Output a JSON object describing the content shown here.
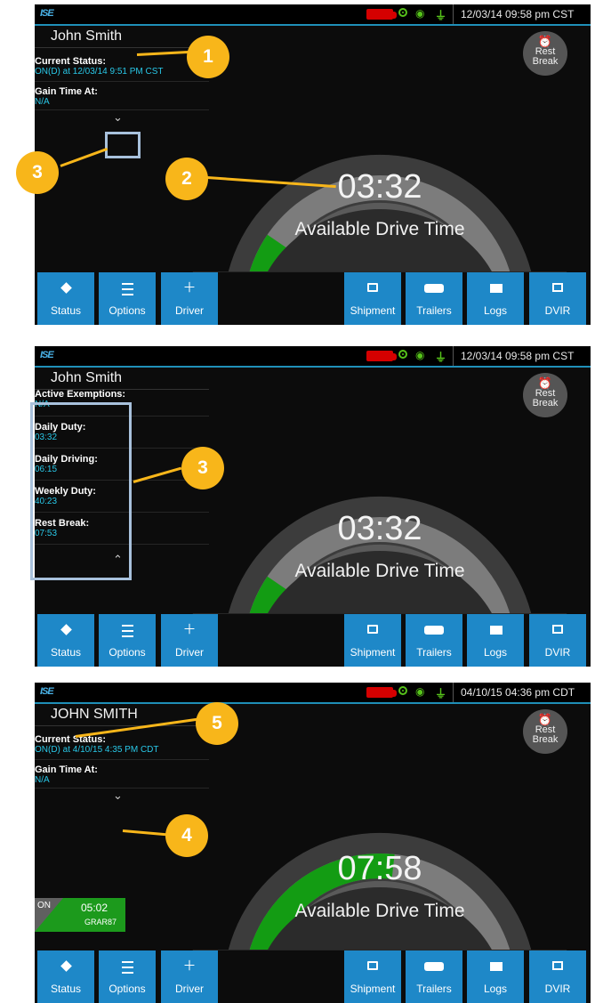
{
  "panels": [
    {
      "clock": "12/03/14 09:58 pm CST",
      "driver": "John Smith",
      "fields": [
        {
          "label": "Current Status:",
          "value": "ON(D) at 12/03/14 9:51 PM CST"
        },
        {
          "label": "Gain Time At:",
          "value": "N/A"
        }
      ],
      "toggle_icon": "chevron-down-icon",
      "time": "03:32",
      "caption": "Available Drive Time",
      "gauge_fraction": 0.23
    },
    {
      "clock": "12/03/14 09:58 pm CST",
      "driver": "John Smith",
      "fields": [
        {
          "label": "Active Exemptions:",
          "value": "N/A"
        },
        {
          "label": "Daily Duty:",
          "value": "03:32"
        },
        {
          "label": "Daily Driving:",
          "value": "06:15"
        },
        {
          "label": "Weekly Duty:",
          "value": "40:23"
        },
        {
          "label": "Rest Break:",
          "value": "07:53"
        }
      ],
      "toggle_icon": "chevron-up-icon",
      "time": "03:32",
      "caption": "Available Drive Time",
      "gauge_fraction": 0.23
    },
    {
      "clock": "04/10/15 04:36 pm CDT",
      "driver": "JOHN SMITH",
      "fields": [
        {
          "label": "Current Status:",
          "value": "ON(D) at 4/10/15 4:35 PM CDT"
        },
        {
          "label": "Gain Time At:",
          "value": "N/A"
        }
      ],
      "toggle_icon": "chevron-down-icon",
      "time": "07:58",
      "caption": "Available Drive Time",
      "gauge_fraction": 0.53,
      "tile": {
        "status": "ON",
        "time": "05:02",
        "code": "GRAR87"
      }
    }
  ],
  "rest_break": {
    "line1": "Rest",
    "line2": "Break",
    "icon": "alarm-clock-icon"
  },
  "buttons_left": [
    {
      "label": "Status",
      "icon": "status-diamond-icon"
    },
    {
      "label": "Options",
      "icon": "options-list-icon"
    },
    {
      "label": "Driver",
      "icon": "plus-icon"
    }
  ],
  "buttons_right": [
    {
      "label": "Shipment",
      "icon": "shipment-box-icon"
    },
    {
      "label": "Trailers",
      "icon": "trailer-icon"
    },
    {
      "label": "Logs",
      "icon": "logbook-icon"
    },
    {
      "label": "DVIR",
      "icon": "dvir-card-icon"
    }
  ],
  "callouts": [
    "1",
    "2",
    "3",
    "3",
    "4",
    "5"
  ],
  "colors": {
    "accent": "#1e88c8",
    "gauge_fill": "#139c13",
    "callout": "#f8b61a",
    "value_text": "#29c8e8",
    "truck_icon": "#d50000"
  }
}
